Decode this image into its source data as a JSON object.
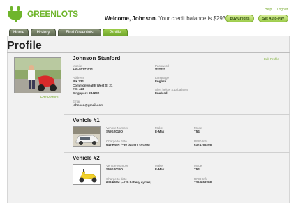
{
  "brand": {
    "name": "GREENLOTS",
    "color": "#6fb52c",
    "icon": "plug-icon"
  },
  "top_links": {
    "help": "Help",
    "logout": "Logout"
  },
  "welcome": {
    "prefix": "Welcome, Johnson.",
    "balance_text": "Your credit balance is $293.08"
  },
  "buttons": {
    "buy_credits": "Buy Credits",
    "set_auto_pay": "Set Auto-Pay"
  },
  "tabs": [
    {
      "label": "Home"
    },
    {
      "label": "History"
    },
    {
      "label": "Find Greenlots"
    },
    {
      "label": "Profile",
      "active": true
    }
  ],
  "page": {
    "title": "Profile"
  },
  "profile": {
    "name": "Johnson Stanford",
    "edit_profile": "Edit Profile",
    "edit_picture": "Edit Picture",
    "mobile": {
      "label": "Mobile",
      "value": "+65-80773021"
    },
    "password": {
      "label": "Password",
      "value": "********"
    },
    "address": {
      "label": "Address",
      "lines": [
        "Blk 234",
        "Commonwealth West St 21",
        "#06-423",
        "Singapore 234232"
      ]
    },
    "language": {
      "label": "Language",
      "value": "English"
    },
    "alert": {
      "label": "Alert below $10 balance",
      "value": "Enabled"
    },
    "email": {
      "label": "Email",
      "value": "johnson@gmail.com"
    }
  },
  "vehicles": [
    {
      "title": "Vehicle #1",
      "vehicle_number": {
        "label": "Vehicle Number",
        "value": "SWG2019D"
      },
      "make": {
        "label": "Make",
        "value": "E-Max"
      },
      "model": {
        "label": "Model",
        "value": "T54"
      },
      "charge": {
        "label": "Charge to date",
        "value": "649 KWH (~30 battery cycles)"
      },
      "rfid": {
        "label": "RFID Info",
        "value": "6374766298"
      }
    },
    {
      "title": "Vehicle #2",
      "vehicle_number": {
        "label": "Vehicle Number",
        "value": "SWG2019D"
      },
      "make": {
        "label": "Make",
        "value": "E-Max"
      },
      "model": {
        "label": "Model",
        "value": "T54"
      },
      "charge": {
        "label": "Charge to date",
        "value": "649 KWH (~120 battery cycles)"
      },
      "rfid": {
        "label": "RFID Info",
        "value": "7364658298"
      }
    }
  ]
}
